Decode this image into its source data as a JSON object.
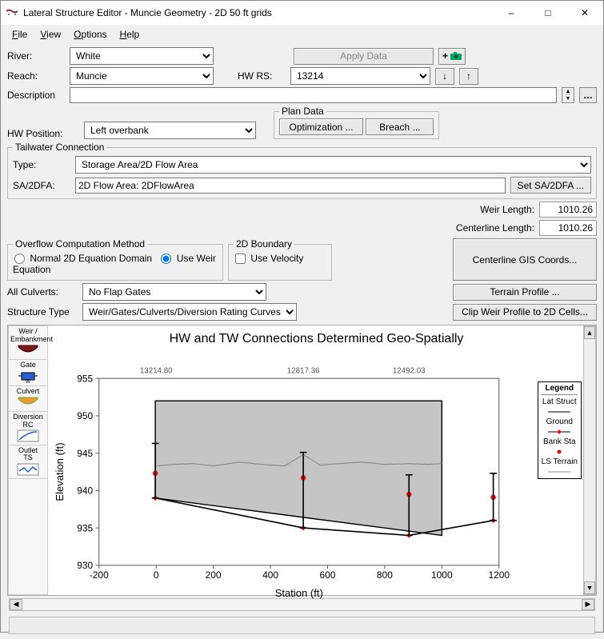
{
  "window": {
    "title": "Lateral Structure Editor - Muncie Geometry - 2D 50 ft grids"
  },
  "menu": {
    "file": "File",
    "view": "View",
    "options": "Options",
    "help": "Help"
  },
  "labels": {
    "river": "River:",
    "reach": "Reach:",
    "description": "Description",
    "hw_rs": "HW RS:",
    "hw_position": "HW Position:",
    "type": "Type:",
    "sa2dfa": "SA/2DFA:",
    "all_culverts": "All Culverts:",
    "structure_type": "Structure Type",
    "weir_length": "Weir Length:",
    "centerline_length": "Centerline Length:"
  },
  "buttons": {
    "apply_data": "Apply Data",
    "optimization": "Optimization ...",
    "breach": "Breach ...",
    "set_sa2dfa": "Set SA/2DFA ...",
    "centerline_gis": "Centerline GIS Coords...",
    "terrain_profile": "Terrain Profile ...",
    "clip_weir": "Clip Weir Profile to 2D Cells..."
  },
  "groups": {
    "plan_data": "Plan Data",
    "tailwater": "Tailwater Connection",
    "overflow": "Overflow Computation Method",
    "boundary_2d": "2D Boundary"
  },
  "values": {
    "river": "White",
    "reach": "Muncie",
    "hw_rs": "13214",
    "description": "",
    "hw_position": "Left overbank",
    "tw_type": "Storage Area/2D Flow Area",
    "sa2dfa": "2D Flow Area: 2DFlowArea",
    "weir_length": "1010.26",
    "centerline_length": "1010.26",
    "all_culverts": "No Flap Gates",
    "structure_type": "Weir/Gates/Culverts/Diversion Rating Curves"
  },
  "overflow": {
    "normal_label": "Normal 2D Equation Domain",
    "weir_label": "Use Weir Equation",
    "selected": "weir"
  },
  "boundary_2d": {
    "use_velocity_label": "Use Velocity",
    "use_velocity_checked": false
  },
  "tools": [
    {
      "label": "Weir /\nEmbankment",
      "id": "weir-embankment"
    },
    {
      "label": "Gate",
      "id": "gate"
    },
    {
      "label": "Culvert",
      "id": "culvert"
    },
    {
      "label": "Diversion\nRC",
      "id": "diversion-rc"
    },
    {
      "label": "Outlet\nTS",
      "id": "outlet-ts"
    }
  ],
  "chart_data": {
    "type": "line",
    "title": "HW and TW Connections Determined Geo-Spatially",
    "xlabel": "Station (ft)",
    "ylabel": "Elevation (ft)",
    "xlim": [
      -200,
      1200
    ],
    "ylim": [
      930,
      955
    ],
    "xticks": [
      -200,
      0,
      200,
      400,
      600,
      800,
      1000,
      1200
    ],
    "yticks": [
      930,
      935,
      940,
      945,
      950,
      955
    ],
    "top_labels": [
      "13214.80",
      "12817.36",
      "12492.03"
    ],
    "top_label_x": [
      0,
      515,
      885
    ],
    "series": [
      {
        "name": "Lat Struct",
        "style": "poly-fill",
        "fill": "#c5c5c5",
        "stroke": "#000",
        "x": [
          -3,
          -3,
          1000,
          1000
        ],
        "y": [
          939.0,
          952.0,
          952.0,
          934.0
        ]
      },
      {
        "name": "Ground",
        "style": "line-dot",
        "stroke": "#000",
        "marker_fill": "#ff0000",
        "x": [
          -3,
          515,
          885,
          1180
        ],
        "y": [
          939.0,
          935.0,
          934.0,
          936.0
        ]
      },
      {
        "name": "Bank Sta",
        "style": "marker",
        "stroke": "#ff0000",
        "x": [
          -3,
          515,
          885,
          1180
        ],
        "y": [
          942.3,
          941.7,
          939.5,
          939.1
        ]
      },
      {
        "name": "LS Terrain",
        "style": "line",
        "stroke": "#888",
        "x": [
          -3,
          60,
          130,
          200,
          290,
          370,
          450,
          515,
          575,
          640,
          720,
          800,
          885,
          950,
          1000
        ],
        "y": [
          943.3,
          943.5,
          943.6,
          943.3,
          943.8,
          943.5,
          943.3,
          944.8,
          943.4,
          943.6,
          943.8,
          943.5,
          943.6,
          943.5,
          943.6
        ]
      }
    ],
    "error_bars": {
      "x": [
        -3,
        515,
        885,
        1180
      ],
      "low": [
        939.0,
        935.0,
        934.0,
        936.0
      ],
      "high": [
        946.3,
        945.1,
        942.1,
        942.3
      ]
    },
    "legend_title": "Legend",
    "legend_items": [
      "Lat Struct",
      "Ground",
      "Bank Sta",
      "LS Terrain"
    ]
  }
}
